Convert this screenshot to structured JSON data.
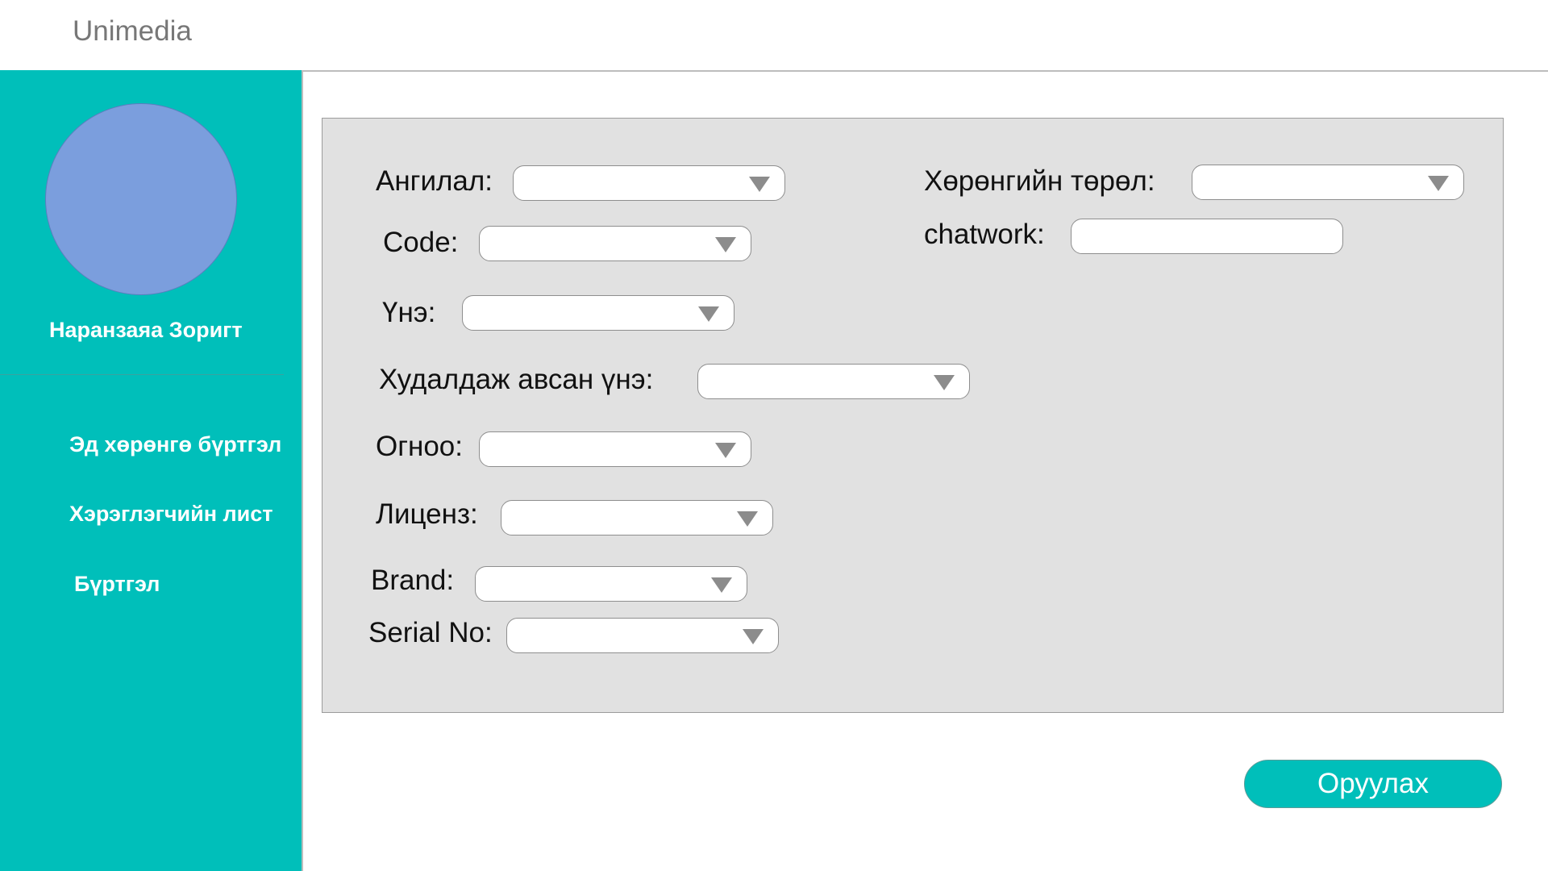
{
  "app": {
    "title": "Unimedia"
  },
  "sidebar": {
    "user_name": "Наранзаяа Зоригт",
    "items": [
      {
        "label": "Эд хөрөнгө бүртгэл"
      },
      {
        "label": "Хэрэглэгчийн лист"
      },
      {
        "label": "Бүртгэл"
      }
    ]
  },
  "form": {
    "angilal": {
      "label": "Ангилал:",
      "value": ""
    },
    "code": {
      "label": "Code:",
      "value": ""
    },
    "une": {
      "label": "Үнэ:",
      "value": ""
    },
    "purchase_price": {
      "label": "Худалдаж авсан үнэ:",
      "value": ""
    },
    "ognoo": {
      "label": "Огноо:",
      "value": ""
    },
    "license": {
      "label": "Лиценз:",
      "value": ""
    },
    "brand": {
      "label": "Brand:",
      "value": ""
    },
    "serial": {
      "label": "Serial No:",
      "value": ""
    },
    "asset_type": {
      "label": "Хөрөнгийн төрөл:",
      "value": ""
    },
    "chatwork": {
      "label": "chatwork:",
      "value": ""
    }
  },
  "actions": {
    "submit_label": "Оруулах"
  },
  "colors": {
    "accent": "#00bfba",
    "avatar": "#7b9edd",
    "panel": "#e1e1e1"
  },
  "icons": {
    "dropdown": "triangle-down-icon"
  }
}
